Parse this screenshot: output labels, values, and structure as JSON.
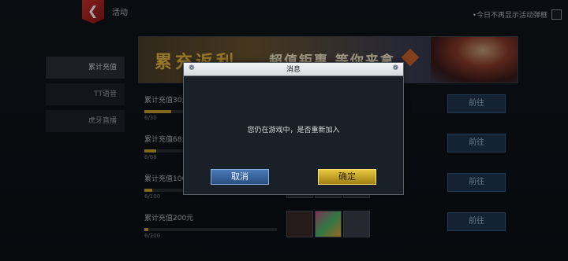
{
  "header": {
    "title": "活动",
    "no_show_label": "•今日不再显示活动弹框"
  },
  "sidebar": {
    "items": [
      {
        "label": "累计充值",
        "active": true
      },
      {
        "label": "TT语音",
        "active": false
      },
      {
        "label": "虎牙直播",
        "active": false
      }
    ]
  },
  "banner": {
    "headline": "累充返利",
    "subline": "超值钜惠 等你来拿"
  },
  "rows": [
    {
      "label": "累计充值30元",
      "count": "6/30",
      "progress": 0.2,
      "button": "前往"
    },
    {
      "label": "累计充值68元",
      "count": "6/68",
      "progress": 0.09,
      "button": "前往"
    },
    {
      "label": "累计充值100元",
      "count": "6/100",
      "progress": 0.06,
      "button": "前往"
    },
    {
      "label": "累计充值200元",
      "count": "6/200",
      "progress": 0.03,
      "button": "前往"
    }
  ],
  "dialog": {
    "title": "消息",
    "message": "您仍在游戏中，是否重新加入",
    "cancel_label": "取消",
    "confirm_label": "确定"
  },
  "colors": {
    "accent_gold": "#c8a030",
    "back_red": "#c9302c",
    "cancel_blue": "#3a64a0",
    "confirm_gold": "#d4b020"
  }
}
